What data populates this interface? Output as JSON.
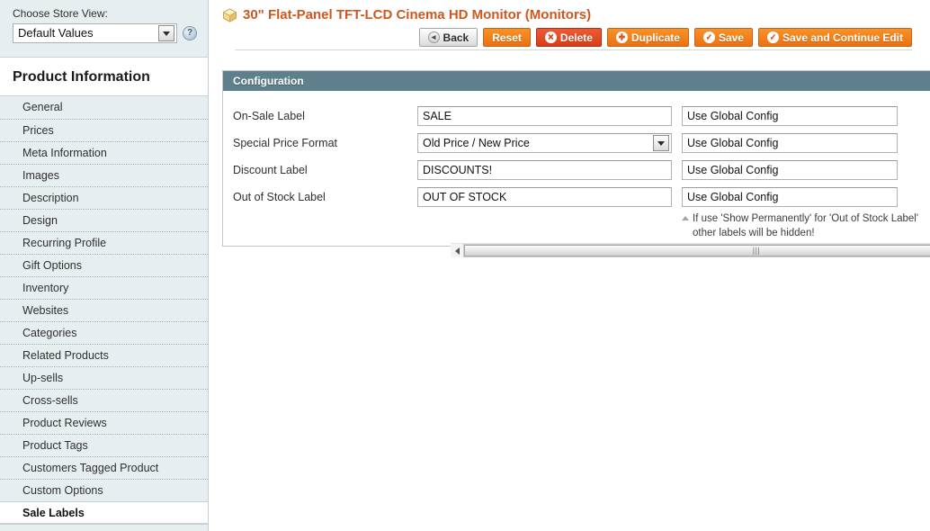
{
  "sidebar": {
    "store_switcher": {
      "label": "Choose Store View:",
      "selected": "Default Values",
      "help_icon": "help-circle-icon",
      "dropdown_icon": "chevron-down-icon"
    },
    "panel_title": "Product Information",
    "items": [
      {
        "label": "General",
        "active": false
      },
      {
        "label": "Prices",
        "active": false
      },
      {
        "label": "Meta Information",
        "active": false
      },
      {
        "label": "Images",
        "active": false
      },
      {
        "label": "Description",
        "active": false
      },
      {
        "label": "Design",
        "active": false
      },
      {
        "label": "Recurring Profile",
        "active": false
      },
      {
        "label": "Gift Options",
        "active": false
      },
      {
        "label": "Inventory",
        "active": false
      },
      {
        "label": "Websites",
        "active": false
      },
      {
        "label": "Categories",
        "active": false
      },
      {
        "label": "Related Products",
        "active": false
      },
      {
        "label": "Up-sells",
        "active": false
      },
      {
        "label": "Cross-sells",
        "active": false
      },
      {
        "label": "Product Reviews",
        "active": false
      },
      {
        "label": "Product Tags",
        "active": false
      },
      {
        "label": "Customers Tagged Product",
        "active": false
      },
      {
        "label": "Custom Options",
        "active": false
      },
      {
        "label": "Sale Labels",
        "active": true
      }
    ]
  },
  "header": {
    "icon": "product-box-icon",
    "title": "30\" Flat-Panel TFT-LCD Cinema HD Monitor (Monitors)",
    "title_color": "#d1561d",
    "buttons": [
      {
        "label": "Back",
        "style": "grey",
        "icon": "back-arrow-icon"
      },
      {
        "label": "Reset",
        "style": "orange",
        "icon": ""
      },
      {
        "label": "Delete",
        "style": "red",
        "icon": "delete-x-icon"
      },
      {
        "label": "Duplicate",
        "style": "orange",
        "icon": "plus-icon"
      },
      {
        "label": "Save",
        "style": "orange",
        "icon": "check-icon"
      },
      {
        "label": "Save and Continue Edit",
        "style": "orange",
        "icon": "check-icon"
      }
    ]
  },
  "fieldset": {
    "legend": "Configuration",
    "accent_color": "#5e7f8c",
    "rows": [
      {
        "label": "On-Sale Label",
        "type": "text",
        "value": "SALE",
        "scope": "Use Global Config"
      },
      {
        "label": "Special Price Format",
        "type": "select",
        "value": "Old Price / New Price",
        "scope": "Use Global Config"
      },
      {
        "label": "Discount Label",
        "type": "text",
        "value": "DISCOUNTS!",
        "scope": "Use Global Config"
      },
      {
        "label": "Out of Stock Label",
        "type": "text",
        "value": "OUT OF STOCK",
        "scope": "Use Global Config"
      }
    ],
    "note_line1": "If use 'Show Permanently' for 'Out of Stock Label'",
    "note_line2": "other labels will be hidden!"
  },
  "scrollbar": {
    "left_icon": "scroll-left-arrow-icon",
    "right_icon": "scroll-right-arrow-icon",
    "grip": "|||"
  }
}
